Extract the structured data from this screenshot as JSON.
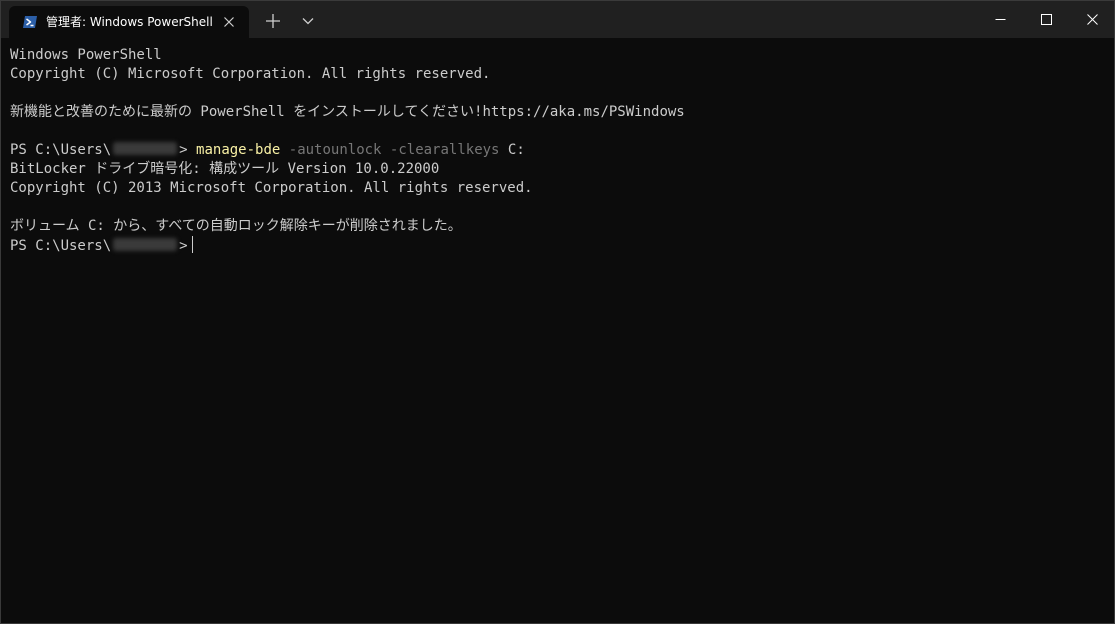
{
  "window": {
    "tab_title": "管理者: Windows PowerShell",
    "tab_icon": "powershell-icon",
    "buttons": {
      "new_tab": "plus-icon",
      "dropdown": "chevron-down-icon",
      "minimize": "minimize-icon",
      "maximize": "maximize-icon",
      "close": "close-icon"
    }
  },
  "terminal": {
    "banner_title": "Windows PowerShell",
    "banner_copyright": "Copyright (C) Microsoft Corporation. All rights reserved.",
    "update_message": "新機能と改善のために最新の PowerShell をインストールしてください!https://aka.ms/PSWindows",
    "prompt_prefix": "PS C:\\Users\\",
    "prompt_suffix": ">",
    "command_name": "manage-bde",
    "command_args": "-autounlock -clearallkeys",
    "command_target": "C:",
    "output_tool": "BitLocker ドライブ暗号化: 構成ツール Version 10.0.22000",
    "output_copyright": "Copyright (C) 2013 Microsoft Corporation. All rights reserved.",
    "result_message": "ボリューム C: から、すべての自動ロック解除キーが削除されました。"
  },
  "colors": {
    "background": "#0c0c0c",
    "titlebar": "#202020",
    "text": "#cccccc",
    "command": "#f9f1a5",
    "parameter": "#767676"
  }
}
